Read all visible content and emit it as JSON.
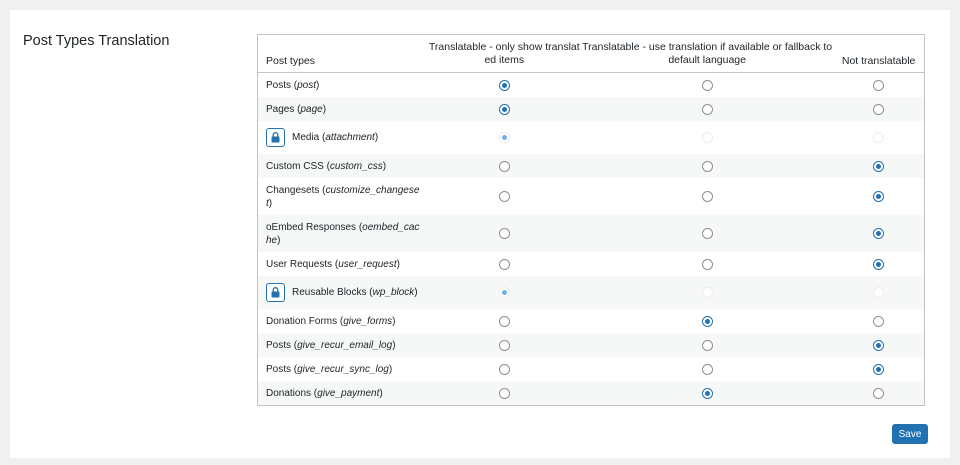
{
  "section": {
    "title": "Post Types Translation"
  },
  "table": {
    "headers": {
      "name": "Post types",
      "translatable_only": "Translatable - only show translated items",
      "translatable_fallback": "Translatable - use translation if available or fallback to default language",
      "not_translatable": "Not translatable"
    },
    "rows": [
      {
        "label": "Posts (",
        "slug": "post",
        "close": ")",
        "locked": false,
        "selected": "translatable_only"
      },
      {
        "label": "Pages (",
        "slug": "page",
        "close": ")",
        "locked": false,
        "selected": "translatable_only"
      },
      {
        "label": "Media (",
        "slug": "attachment",
        "close": ")",
        "locked": true,
        "selected": "translatable_only"
      },
      {
        "label": "Custom CSS (",
        "slug": "custom_css",
        "close": ")",
        "locked": false,
        "selected": "not_translatable"
      },
      {
        "label": "Changesets (",
        "slug": "customize_changeset",
        "close": ")",
        "locked": false,
        "selected": "not_translatable"
      },
      {
        "label": "oEmbed Responses (",
        "slug": "oembed_cache",
        "close": ")",
        "locked": false,
        "selected": "not_translatable"
      },
      {
        "label": "User Requests (",
        "slug": "user_request",
        "close": ")",
        "locked": false,
        "selected": "not_translatable"
      },
      {
        "label": "Reusable Blocks (",
        "slug": "wp_block",
        "close": ")",
        "locked": true,
        "selected": "translatable_only"
      },
      {
        "label": "Donation Forms (",
        "slug": "give_forms",
        "close": ")",
        "locked": false,
        "selected": "translatable_fallback"
      },
      {
        "label": "Posts (",
        "slug": "give_recur_email_log",
        "close": ")",
        "locked": false,
        "selected": "not_translatable"
      },
      {
        "label": "Posts (",
        "slug": "give_recur_sync_log",
        "close": ")",
        "locked": false,
        "selected": "not_translatable"
      },
      {
        "label": "Donations (",
        "slug": "give_payment",
        "close": ")",
        "locked": false,
        "selected": "translatable_fallback"
      }
    ]
  },
  "save_button": {
    "label": "Save"
  },
  "colors": {
    "accent": "#2271b1",
    "border": "#c3c4c7",
    "stripe": "#f6f7f7",
    "background": "#f0f0f1"
  },
  "icons": {
    "lock": "lock-icon"
  }
}
